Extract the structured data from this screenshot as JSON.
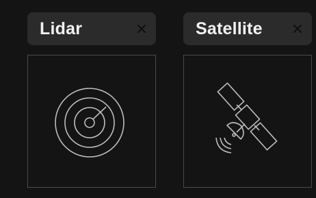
{
  "cards": [
    {
      "label": "Lidar",
      "close_icon": "close-icon",
      "icon": "radar-icon"
    },
    {
      "label": "Satellite",
      "close_icon": "close-icon",
      "icon": "satellite-icon"
    }
  ],
  "colors": {
    "background": "#141414",
    "chip_background": "#2b2b2b",
    "chip_text": "#f2f2f2",
    "tile_border": "#4a4a4a",
    "icon_stroke": "#bdbdbd",
    "close_icon": "#111111"
  }
}
